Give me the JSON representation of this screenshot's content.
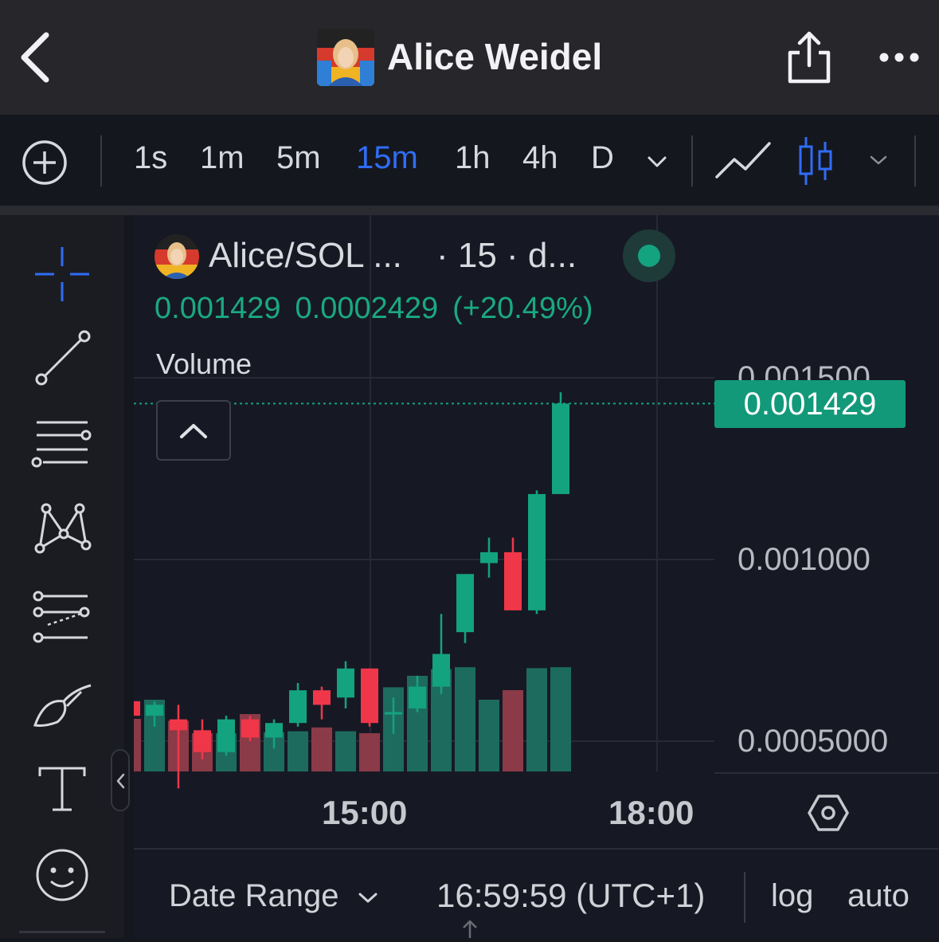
{
  "header": {
    "title": "Alice Weidel"
  },
  "toolbar": {
    "timeframes": [
      "1s",
      "1m",
      "5m",
      "15m",
      "1h",
      "4h",
      "D"
    ],
    "active_timeframe": "15m"
  },
  "legend": {
    "pair": "Alice/SOL ...",
    "interval": "· 15 · d...",
    "price": "0.001429",
    "change": "0.0002429",
    "change_pct": "(+20.49%)",
    "volume_label": "Volume"
  },
  "price_axis": {
    "labels": [
      "0.001500",
      "0.001000",
      "0.0005000"
    ],
    "last_price": "0.001429"
  },
  "time_axis": {
    "labels": [
      "15:00",
      "18:00"
    ]
  },
  "bottom_bar": {
    "date_range": "Date Range",
    "clock": "16:59:59 (UTC+1)",
    "log": "log",
    "auto": "auto"
  },
  "colors": {
    "up": "#14a37f",
    "down": "#f0374a",
    "up_volume": "#1d6b5f",
    "down_volume": "#8b3a47",
    "accent": "#2f6df5"
  },
  "chart_data": {
    "type": "candlestick",
    "interval": "15m",
    "y_axis_ticks": [
      0.0005,
      0.001,
      0.0015
    ],
    "candles": [
      {
        "o": 0.00057,
        "h": 0.00061,
        "l": 0.00054,
        "c": 0.0006
      },
      {
        "o": 0.00056,
        "h": 0.0006,
        "l": 0.00037,
        "c": 0.00053
      },
      {
        "o": 0.00053,
        "h": 0.00056,
        "l": 0.00045,
        "c": 0.00047
      },
      {
        "o": 0.00047,
        "h": 0.00057,
        "l": 0.00046,
        "c": 0.00056
      },
      {
        "o": 0.00056,
        "h": 0.00057,
        "l": 0.0005,
        "c": 0.00051
      },
      {
        "o": 0.00051,
        "h": 0.00056,
        "l": 0.00048,
        "c": 0.00055
      },
      {
        "o": 0.00055,
        "h": 0.00066,
        "l": 0.00054,
        "c": 0.00064
      },
      {
        "o": 0.00064,
        "h": 0.00065,
        "l": 0.00056,
        "c": 0.0006
      },
      {
        "o": 0.00062,
        "h": 0.00072,
        "l": 0.00059,
        "c": 0.0007
      },
      {
        "o": 0.0007,
        "h": 0.0007,
        "l": 0.00054,
        "c": 0.00055
      },
      {
        "o": 0.00058,
        "h": 0.00062,
        "l": 0.00052,
        "c": 0.00058
      },
      {
        "o": 0.00059,
        "h": 0.00068,
        "l": 0.00058,
        "c": 0.00065
      },
      {
        "o": 0.00065,
        "h": 0.00085,
        "l": 0.00063,
        "c": 0.00074
      },
      {
        "o": 0.0008,
        "h": 0.00095,
        "l": 0.00077,
        "c": 0.00096
      },
      {
        "o": 0.00099,
        "h": 0.00106,
        "l": 0.00095,
        "c": 0.00102
      },
      {
        "o": 0.00102,
        "h": 0.00106,
        "l": 0.00086,
        "c": 0.00086
      },
      {
        "o": 0.00086,
        "h": 0.00119,
        "l": 0.00085,
        "c": 0.00118
      },
      {
        "o": 0.00118,
        "h": 0.00146,
        "l": 0.00118,
        "c": 0.001429
      }
    ],
    "volumes": [
      0.55,
      0.75,
      0.53,
      0.4,
      0.4,
      0.6,
      0.41,
      0.42,
      0.46,
      0.42,
      0.4,
      0.88,
      1.0,
      1.07,
      1.09,
      0.75,
      0.85,
      1.08,
      1.09
    ]
  }
}
